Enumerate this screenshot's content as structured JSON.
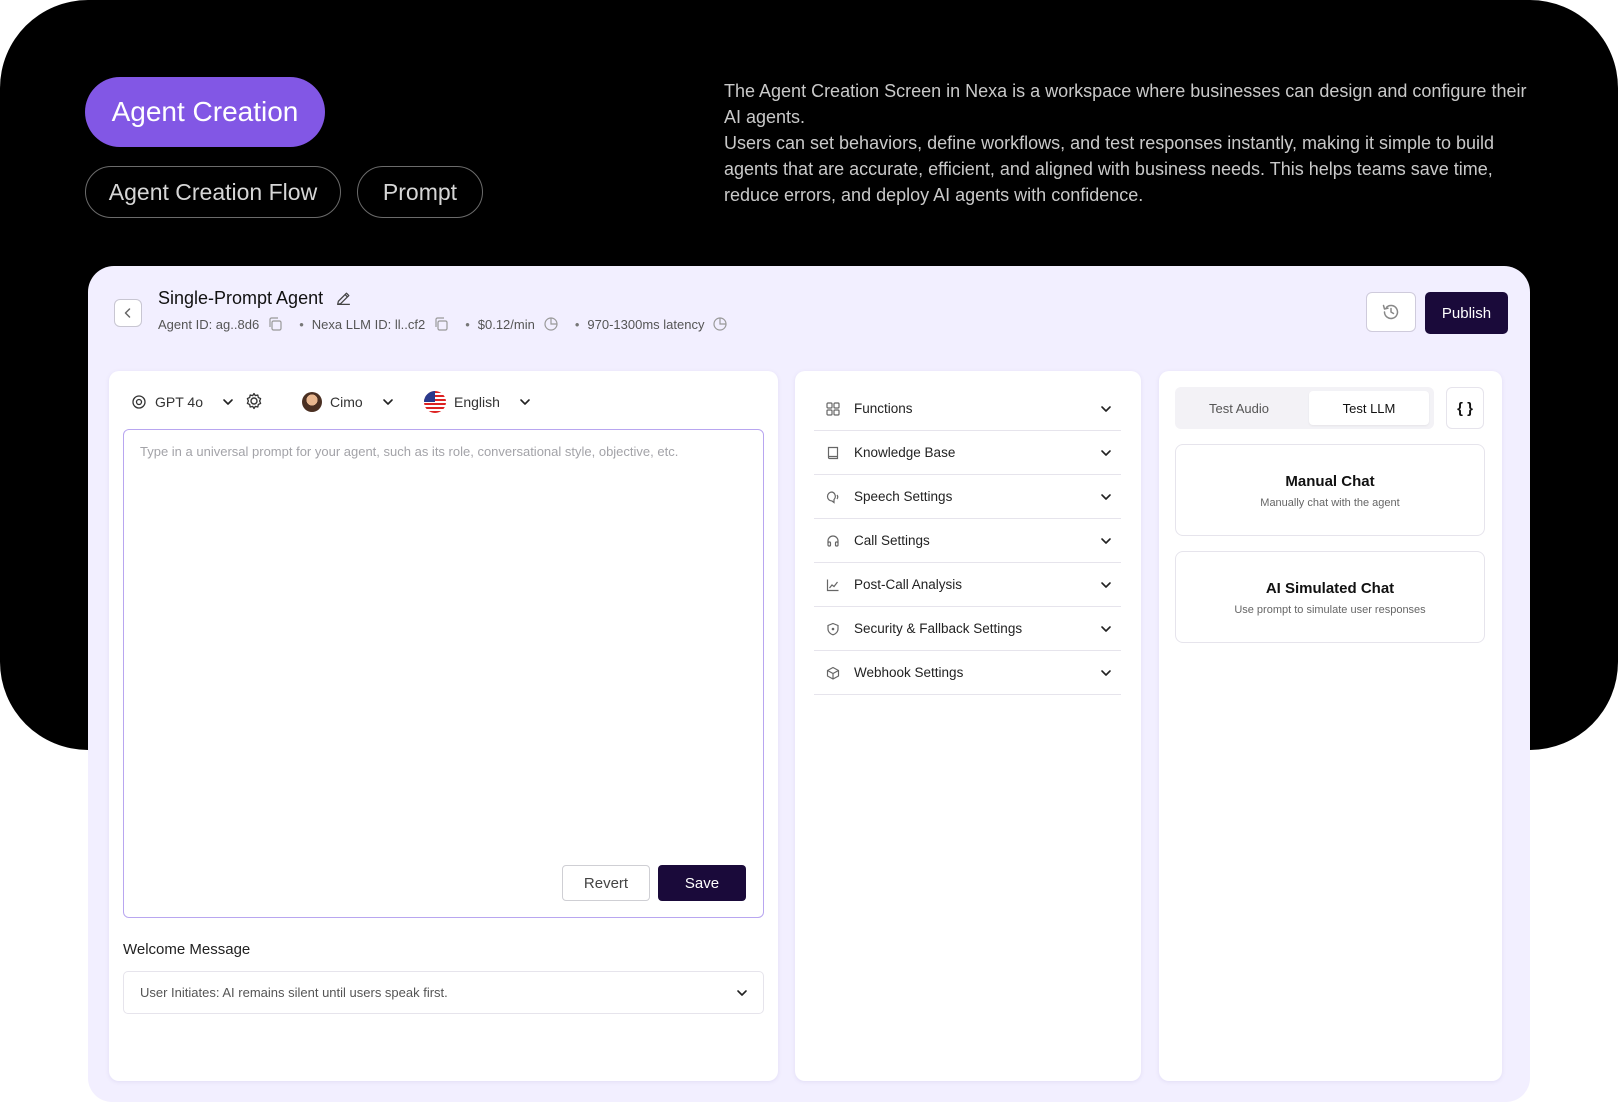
{
  "header": {
    "main_pill": "Agent Creation",
    "pills": [
      "Agent Creation Flow",
      "Prompt"
    ],
    "intro_p1": "The Agent Creation Screen in Nexa is a workspace where businesses can design and configure their AI agents.",
    "intro_p2": "Users can set behaviors, define workflows, and test responses instantly, making it simple to build agents that are accurate, efficient, and aligned with business needs. This helps teams save time, reduce errors, and deploy AI agents with confidence."
  },
  "agent": {
    "title": "Single-Prompt Agent",
    "agent_id": "Agent ID: ag..8d6",
    "llm_id": "Nexa LLM ID: ll..cf2",
    "price": "$0.12/min",
    "latency": "970-1300ms latency",
    "publish_label": "Publish"
  },
  "left_panel": {
    "model": "GPT 4o",
    "voice": "Cimo",
    "language": "English",
    "prompt_placeholder": "Type in a universal prompt for your agent, such as its role, conversational style, objective, etc.",
    "revert_label": "Revert",
    "save_label": "Save",
    "welcome_label": "Welcome Message",
    "welcome_value": "User Initiates: AI remains silent until users speak first."
  },
  "settings": {
    "items": [
      {
        "label": "Functions",
        "icon": "functions-icon"
      },
      {
        "label": "Knowledge Base",
        "icon": "book-icon"
      },
      {
        "label": "Speech Settings",
        "icon": "speech-icon"
      },
      {
        "label": "Call Settings",
        "icon": "headset-icon"
      },
      {
        "label": "Post-Call Analysis",
        "icon": "chart-icon"
      },
      {
        "label": "Security & Fallback Settings",
        "icon": "shield-icon"
      },
      {
        "label": "Webhook Settings",
        "icon": "cube-icon"
      }
    ]
  },
  "test_panel": {
    "tabs": [
      "Test Audio",
      "Test LLM"
    ],
    "json_label": "{ }",
    "cards": [
      {
        "title": "Manual Chat",
        "subtitle": "Manually chat with the agent"
      },
      {
        "title": "AI Simulated Chat",
        "subtitle": "Use prompt to simulate user responses"
      }
    ]
  },
  "colors": {
    "accent": "#8257e5",
    "primary_button": "#1a0a3a",
    "app_bg": "#f2efff",
    "banner_bg": "#000000"
  }
}
